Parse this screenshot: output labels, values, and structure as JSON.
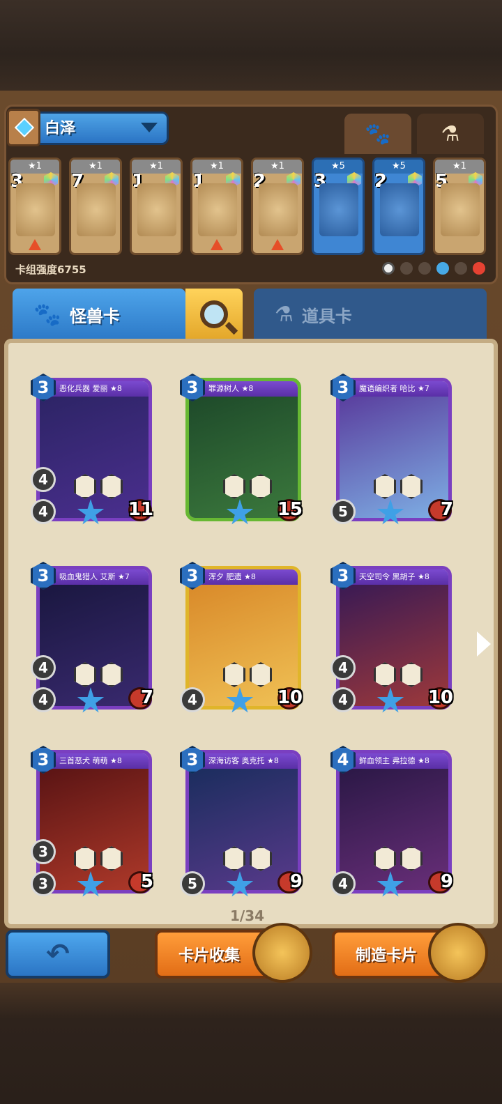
{
  "deck": {
    "name": "白泽",
    "power_label": "卡组强度6755",
    "cards": [
      {
        "stars": "★1",
        "cost": "3",
        "style": "tan"
      },
      {
        "stars": "★1",
        "cost": "7",
        "style": "tan"
      },
      {
        "stars": "★1",
        "cost": "1",
        "style": "tan"
      },
      {
        "stars": "★1",
        "cost": "1",
        "style": "tan"
      },
      {
        "stars": "★1",
        "cost": "2",
        "style": "tan"
      },
      {
        "stars": "★5",
        "cost": "3",
        "style": "blue"
      },
      {
        "stars": "★5",
        "cost": "2",
        "style": "blue"
      },
      {
        "stars": "★1",
        "cost": "5",
        "style": "tan"
      }
    ]
  },
  "tabs": {
    "monster": "怪兽卡",
    "item": "道具卡"
  },
  "cards": [
    {
      "title": "恶化兵器 爱丽 ★8",
      "cost": "3",
      "stat1": "4",
      "stat2": "4",
      "hp": "11",
      "frame": "purple",
      "art": [
        "#2d2466",
        "#4b2f8f"
      ]
    },
    {
      "title": "罪源树人 ★8",
      "cost": "3",
      "stat1": "",
      "stat2": "",
      "hp": "15",
      "frame": "green",
      "art": [
        "#1e4a2a",
        "#3c7a3d"
      ]
    },
    {
      "title": "魔语编织者 哈比 ★7",
      "cost": "3",
      "stat1": "",
      "stat2": "5",
      "hp": "7",
      "frame": "purple",
      "art": [
        "#5a3e9e",
        "#7fb2e6"
      ]
    },
    {
      "title": "吸血鬼猎人 艾斯 ★7",
      "cost": "3",
      "stat1": "4",
      "stat2": "4",
      "hp": "7",
      "frame": "purple",
      "art": [
        "#1a1740",
        "#3a2a70"
      ]
    },
    {
      "title": "浑夕 肥遗 ★8",
      "cost": "3",
      "stat1": "",
      "stat2": "4",
      "hp": "10",
      "frame": "yellow",
      "art": [
        "#d98a2a",
        "#f0c256"
      ]
    },
    {
      "title": "天空司令 黑胡子 ★8",
      "cost": "3",
      "stat1": "4",
      "stat2": "4",
      "hp": "10",
      "frame": "purple",
      "art": [
        "#3a1a54",
        "#a03a3a"
      ]
    },
    {
      "title": "三首恶犬 萌萌 ★8",
      "cost": "3",
      "stat1": "3",
      "stat2": "3",
      "hp": "5",
      "frame": "purple",
      "art": [
        "#5a1414",
        "#b03a2a"
      ]
    },
    {
      "title": "深海访客 奥克托 ★8",
      "cost": "3",
      "stat1": "",
      "stat2": "5",
      "hp": "9",
      "frame": "purple",
      "art": [
        "#1b2d5e",
        "#5a3a8c"
      ]
    },
    {
      "title": "鲜血领主 弗拉德 ★8",
      "cost": "4",
      "stat1": "",
      "stat2": "4",
      "hp": "9",
      "frame": "purple",
      "art": [
        "#2b1846",
        "#6a2f7a"
      ]
    }
  ],
  "pagination": "1/34",
  "buttons": {
    "collect": "卡片收集",
    "craft": "制造卡片"
  }
}
